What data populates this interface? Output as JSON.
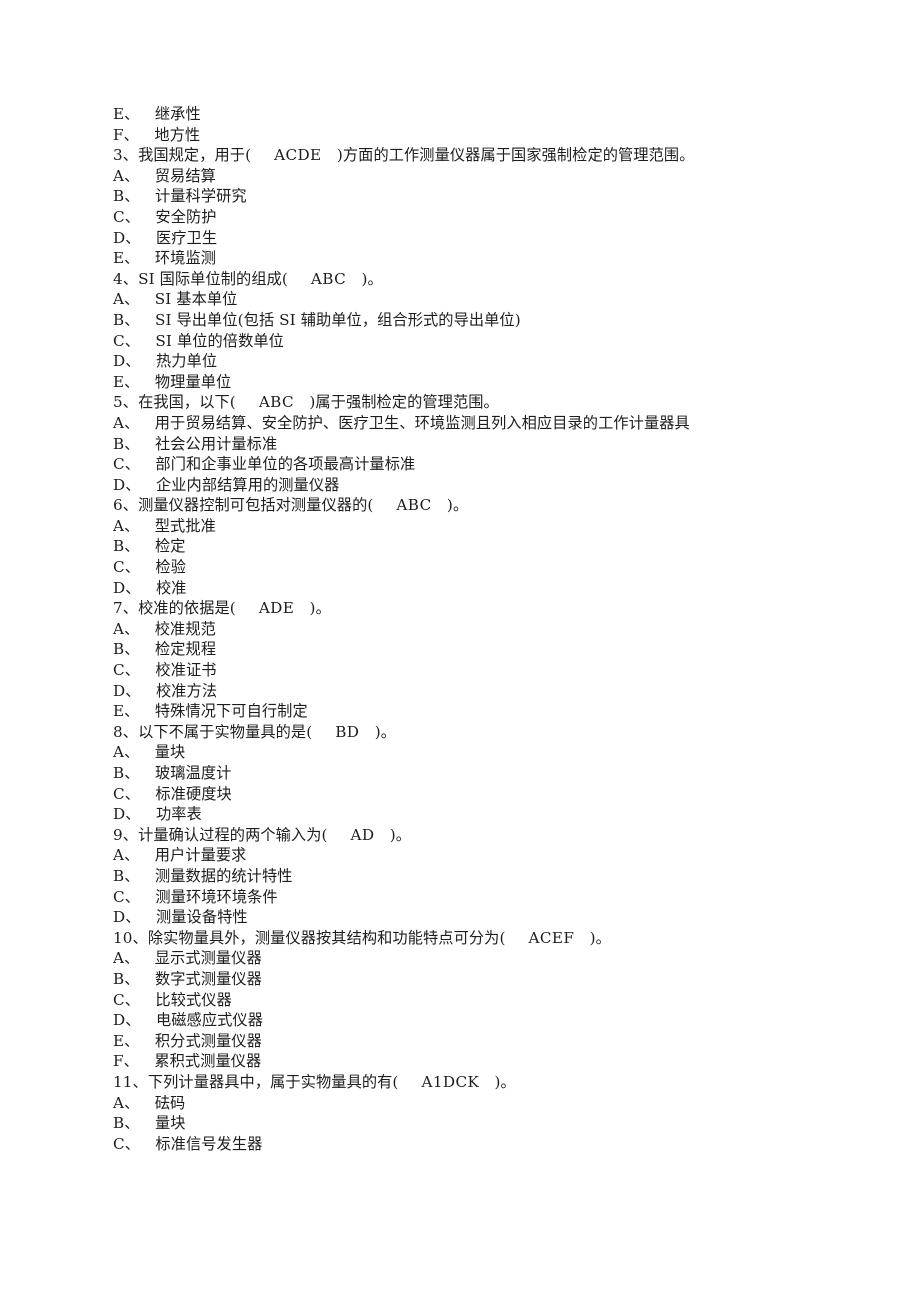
{
  "document": {
    "page_background": "#ffffff",
    "text_color": "#1d1d1d",
    "lines": [
      {
        "kind": "option",
        "label": "E、",
        "text": "继承性"
      },
      {
        "kind": "option",
        "label": "F、",
        "text": "地方性"
      },
      {
        "kind": "stem",
        "number": "3、",
        "text_before": "我国规定，用于(",
        "answer": "ACDE",
        "text_after": ")方面的工作测量仪器属于国家强制检定的管理范围。"
      },
      {
        "kind": "option",
        "label": "A、",
        "text": "贸易结算"
      },
      {
        "kind": "option",
        "label": "B、",
        "text": "计量科学研究"
      },
      {
        "kind": "option",
        "label": "C、",
        "text": "安全防护"
      },
      {
        "kind": "option",
        "label": "D、",
        "text": "医疗卫生"
      },
      {
        "kind": "option",
        "label": "E、",
        "text": "环境监测"
      },
      {
        "kind": "stem",
        "number": "4、",
        "text_before": "SI 国际单位制的组成(",
        "answer": "ABC",
        "text_after": ")。"
      },
      {
        "kind": "option",
        "label": "A、",
        "text": "SI 基本单位"
      },
      {
        "kind": "option",
        "label": "B、",
        "text": "SI 导出单位(包括 SI 辅助单位，组合形式的导出单位)"
      },
      {
        "kind": "option",
        "label": "C、",
        "text": "SI 单位的倍数单位"
      },
      {
        "kind": "option",
        "label": "D、",
        "text": "热力单位"
      },
      {
        "kind": "option",
        "label": "E、",
        "text": "物理量单位"
      },
      {
        "kind": "stem",
        "number": "5、",
        "text_before": "在我国，以下(",
        "answer": "ABC",
        "text_after": ")属于强制检定的管理范围。"
      },
      {
        "kind": "option",
        "label": "A、",
        "text": "用于贸易结算、安全防护、医疗卫生、环境监测且列入相应目录的工作计量器具"
      },
      {
        "kind": "option",
        "label": "B、",
        "text": "社会公用计量标准"
      },
      {
        "kind": "option",
        "label": "C、",
        "text": "部门和企事业单位的各项最高计量标准"
      },
      {
        "kind": "option",
        "label": "D、",
        "text": "企业内部结算用的测量仪器"
      },
      {
        "kind": "stem",
        "number": "6、",
        "text_before": "测量仪器控制可包括对测量仪器的(",
        "answer": "ABC",
        "text_after": ")。"
      },
      {
        "kind": "option",
        "label": "A、",
        "text": "型式批准"
      },
      {
        "kind": "option",
        "label": "B、",
        "text": "检定"
      },
      {
        "kind": "option",
        "label": "C、",
        "text": "检验"
      },
      {
        "kind": "option",
        "label": "D、",
        "text": "校准"
      },
      {
        "kind": "stem",
        "number": "7、",
        "text_before": "校准的依据是(",
        "answer": "ADE",
        "text_after": ")。"
      },
      {
        "kind": "option",
        "label": "A、",
        "text": "校准规范"
      },
      {
        "kind": "option",
        "label": "B、",
        "text": "检定规程"
      },
      {
        "kind": "option",
        "label": "C、",
        "text": "校准证书"
      },
      {
        "kind": "option",
        "label": "D、",
        "text": "校准方法"
      },
      {
        "kind": "option",
        "label": "E、",
        "text": "特殊情况下可自行制定"
      },
      {
        "kind": "stem",
        "number": "8、",
        "text_before": "以下不属于实物量具的是(",
        "answer": "BD",
        "text_after": ")。"
      },
      {
        "kind": "option",
        "label": "A、",
        "text": "量块"
      },
      {
        "kind": "option",
        "label": "B、",
        "text": "玻璃温度计"
      },
      {
        "kind": "option",
        "label": "C、",
        "text": "标准硬度块"
      },
      {
        "kind": "option",
        "label": "D、",
        "text": "功率表"
      },
      {
        "kind": "stem",
        "number": "9、",
        "text_before": "计量确认过程的两个输入为(",
        "answer": "AD",
        "text_after": ")。"
      },
      {
        "kind": "option",
        "label": "A、",
        "text": "用户计量要求"
      },
      {
        "kind": "option",
        "label": "B、",
        "text": "测量数据的统计特性"
      },
      {
        "kind": "option",
        "label": "C、",
        "text": "测量环境环境条件"
      },
      {
        "kind": "option",
        "label": "D、",
        "text": "测量设备特性"
      },
      {
        "kind": "stem",
        "number": "10、",
        "text_before": "除实物量具外，测量仪器按其结构和功能特点可分为(",
        "answer": "ACEF",
        "text_after": ")。"
      },
      {
        "kind": "option",
        "label": "A、",
        "text": "显示式测量仪器"
      },
      {
        "kind": "option",
        "label": "B、",
        "text": "数字式测量仪器"
      },
      {
        "kind": "option",
        "label": "C、",
        "text": "比较式仪器"
      },
      {
        "kind": "option",
        "label": "D、",
        "text": "电磁感应式仪器"
      },
      {
        "kind": "option",
        "label": "E、",
        "text": "积分式测量仪器"
      },
      {
        "kind": "option",
        "label": "F、",
        "text": "累积式测量仪器"
      },
      {
        "kind": "stem",
        "number": "11、",
        "text_before": "下列计量器具中，属于实物量具的有(",
        "answer": "A1DCK",
        "text_after": ")。"
      },
      {
        "kind": "option",
        "label": "A、",
        "text": "砝码"
      },
      {
        "kind": "option",
        "label": "B、",
        "text": "量块"
      },
      {
        "kind": "option",
        "label": "C、",
        "text": "标准信号发生器"
      }
    ]
  }
}
